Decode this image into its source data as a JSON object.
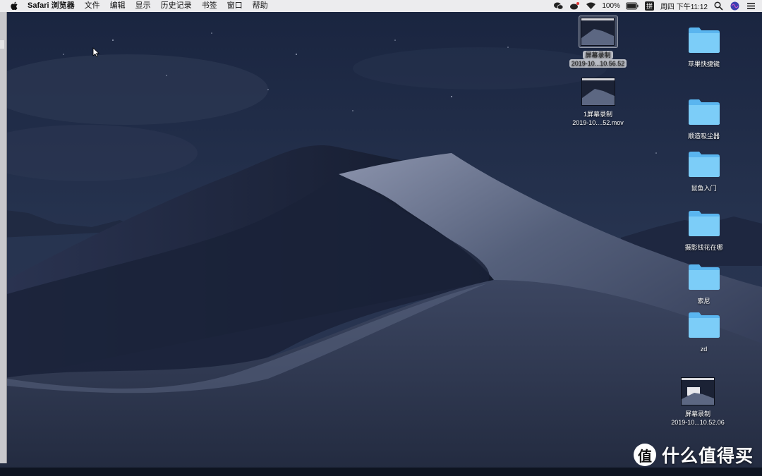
{
  "menubar": {
    "app_name": "Safari 浏览器",
    "menus": [
      "文件",
      "编辑",
      "显示",
      "历史记录",
      "书签",
      "窗口",
      "帮助"
    ],
    "battery": "100%",
    "clock": "周四 下午11:12",
    "status_icons": [
      "wechat-icon",
      "weibo-icon",
      "wifi-icon",
      "battery-icon",
      "input-method-icon",
      "search-icon",
      "siri-icon",
      "notification-center-icon"
    ]
  },
  "desktop_items": {
    "rec1": {
      "name": "屏幕录制",
      "sub": "2019-10...10.56.52"
    },
    "rec2": {
      "name": "1屏幕录制",
      "sub": "2019-10....52.mov"
    },
    "folder1": "苹果快捷键",
    "folder2": "顺造吸尘器",
    "folder3": "鼠鱼入门",
    "folder4": "摄影钱花在哪",
    "folder5": "索尼",
    "folder6": "zd",
    "rec3": {
      "name": "屏幕录制",
      "sub": "2019-10...10.52.06"
    }
  },
  "watermark": {
    "glyph": "值",
    "text": "什么值得买"
  },
  "colors": {
    "folder": "#6ec4f4",
    "sky": "#1c2740",
    "dune": "#4a5570"
  }
}
